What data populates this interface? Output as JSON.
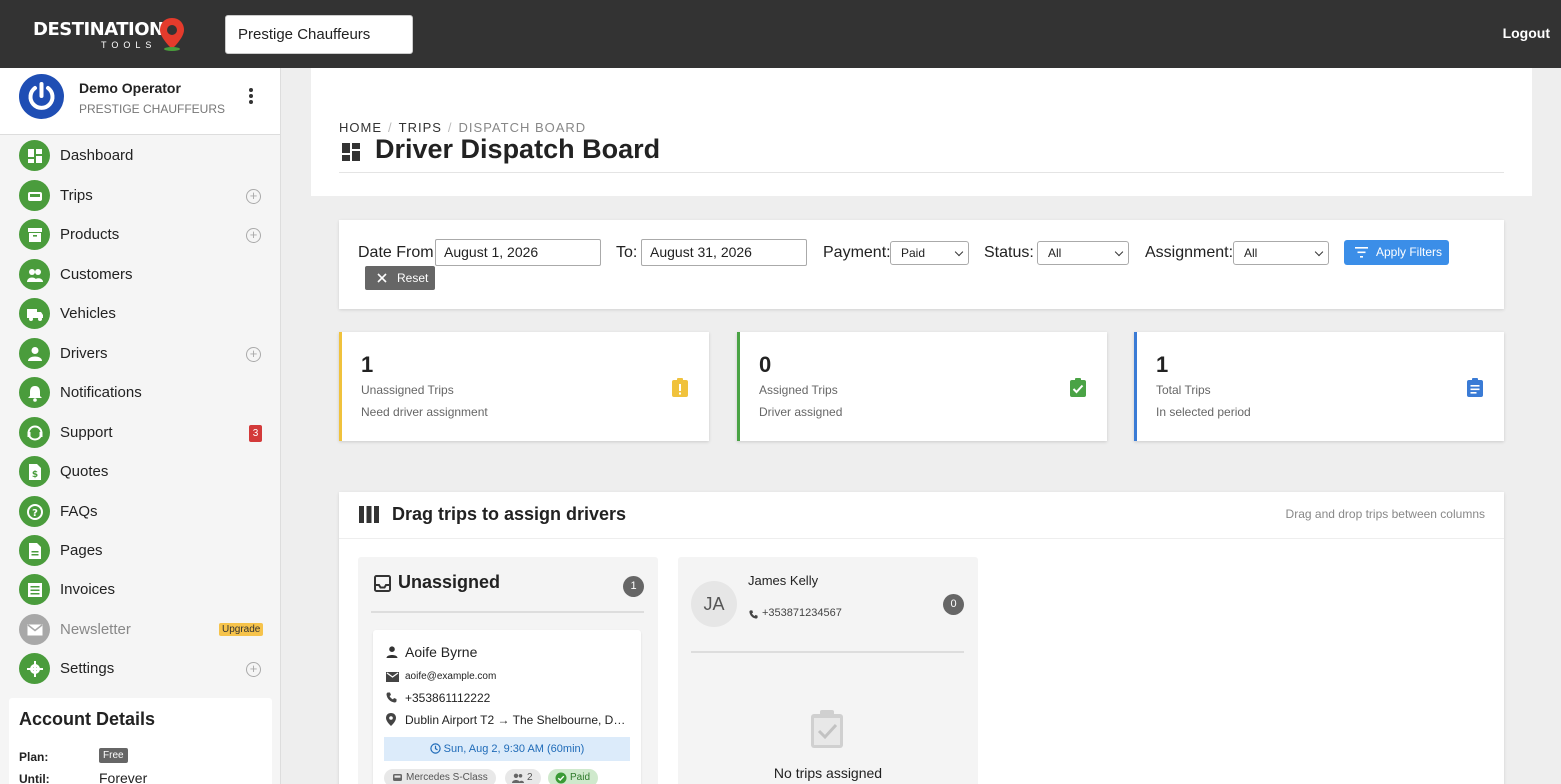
{
  "app": {
    "logo_text": "DESTINATION",
    "logo_sub": "TOOLS",
    "org_value": "Prestige Chauffeurs",
    "logout_label": "Logout"
  },
  "user": {
    "name": "Demo Operator",
    "org": "PRESTIGE CHAUFFEURS"
  },
  "nav": [
    {
      "label": "Dashboard",
      "icon": "dashboard-icon"
    },
    {
      "label": "Trips",
      "icon": "car-icon",
      "plus": true
    },
    {
      "label": "Products",
      "icon": "archive-icon",
      "plus": true
    },
    {
      "label": "Customers",
      "icon": "group-icon"
    },
    {
      "label": "Vehicles",
      "icon": "truck-icon"
    },
    {
      "label": "Drivers",
      "icon": "person-icon",
      "plus": true
    },
    {
      "label": "Notifications",
      "icon": "bell-icon"
    },
    {
      "label": "Support",
      "icon": "support-icon",
      "badge": "3"
    },
    {
      "label": "Quotes",
      "icon": "dollar-doc-icon"
    },
    {
      "label": "FAQs",
      "icon": "question-icon"
    },
    {
      "label": "Pages",
      "icon": "page-icon"
    },
    {
      "label": "Invoices",
      "icon": "invoice-icon"
    },
    {
      "label": "Newsletter",
      "icon": "mail-icon",
      "upgrade": "Upgrade",
      "disabled": true
    },
    {
      "label": "Settings",
      "icon": "gear-icon",
      "plus": true
    }
  ],
  "account": {
    "title": "Account Details",
    "plan_label": "Plan:",
    "plan_value": "Free",
    "until_label": "Until:",
    "until_value": "Forever"
  },
  "breadcrumb": {
    "home": "HOME",
    "trips": "TRIPS",
    "current": "DISPATCH BOARD"
  },
  "page_title": "Driver Dispatch Board",
  "filters": {
    "date_from_label": "Date From:",
    "date_from_value": "August 1, 2026",
    "to_label": "To:",
    "to_value": "August 31, 2026",
    "payment_label": "Payment:",
    "payment_value": "Paid",
    "status_label": "Status:",
    "status_value": "All",
    "assignment_label": "Assignment:",
    "assignment_value": "All",
    "apply_label": "Apply Filters",
    "reset_label": "Reset"
  },
  "stats": [
    {
      "value": "1",
      "label": "Unassigned Trips",
      "sub": "Need driver assignment",
      "color": "#f0c23c",
      "icon": "warning-clipboard-icon"
    },
    {
      "value": "0",
      "label": "Assigned Trips",
      "sub": "Driver assigned",
      "color": "#4aa345",
      "icon": "check-clipboard-icon"
    },
    {
      "value": "1",
      "label": "Total Trips",
      "sub": "In selected period",
      "color": "#3a7bd5",
      "icon": "list-clipboard-icon"
    }
  ],
  "board": {
    "title": "Drag trips to assign drivers",
    "hint": "Drag and drop trips between columns",
    "unassigned": {
      "title": "Unassigned",
      "count": "1",
      "trip": {
        "customer": "Aoife Byrne",
        "email": "aoife@example.com",
        "phone": "+353861112222",
        "route": "Dublin Airport T2 → The Shelbourne, Dubl...",
        "time": "Sun, Aug 2, 9:30 AM (60min)",
        "vehicle": "Mercedes S-Class",
        "passengers": "2",
        "payment": "Paid"
      }
    },
    "driver": {
      "initials": "JA",
      "name": "James Kelly",
      "phone": "+353871234567",
      "count": "0",
      "empty": "No trips assigned"
    }
  },
  "colors": {
    "brand_green": "#4a9c3c",
    "topbar": "#333333",
    "accent_blue": "#3b8ee8"
  }
}
